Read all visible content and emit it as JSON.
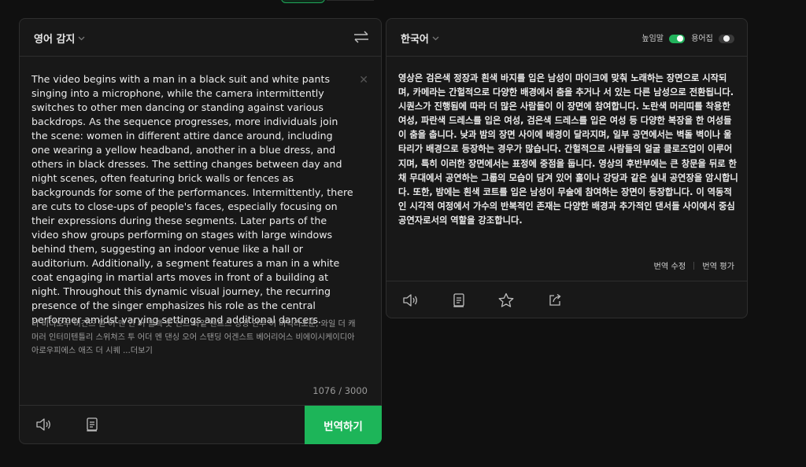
{
  "source": {
    "language": "영어 감지",
    "text": "The video begins with a man in a black suit and white pants singing into a microphone, while the camera intermittently switches to other men dancing or standing against various backdrops. As the sequence progresses, more individuals join the scene: women in different attire dance around, including one wearing a yellow headband, another in a blue dress, and others in black dresses. The setting changes between day and night scenes, often featuring brick walls or fences as backgrounds for some of the performances. Intermittently, there are cuts to close-ups of people's faces, especially focusing on their expressions during these segments. Later parts of the video show groups performing on stages with large windows behind them, suggesting an indoor venue like a hall or auditorium. Additionally, a segment features a man in a white coat engaging in martial arts moves in front of a building at night. Throughout this dynamic visual journey, the recurring presence of the singer emphasizes his role as the central performer amidst varying settings and additional dancers.",
    "romanization": "더 비디오우 비긴즈 윋 어 맨 인 어 블랙 숫 언드 와잍 팬트스 싱잉 인투 어 마익러포운, 와일 더 캐머러 인터미텐틀리 스위쳐즈 투 어더 멘 댄싱 오어 스탠딩 어겐스트 베어리어스 비에이시케이디아아로우피에스 애즈 더 시퀘 ",
    "more_label": "...더보기",
    "char_count": "1076 / 3000",
    "translate_label": "번역하기"
  },
  "target": {
    "language": "한국어",
    "honorific_label": "높임말",
    "glossary_label": "용어집",
    "honorific_on": true,
    "glossary_on": false,
    "text": "영상은 검은색 정장과 흰색 바지를 입은 남성이 마이크에 맞춰 노래하는 장면으로 시작되며, 카메라는 간헐적으로 다양한 배경에서 춤을 추거나 서 있는 다른 남성으로 전환됩니다. 시퀀스가 진행됨에 따라 더 많은 사람들이 이 장면에 참여합니다. 노란색 머리띠를 착용한 여성, 파란색 드레스를 입은 여성, 검은색 드레스를 입은 여성 등 다양한 복장을 한 여성들이 춤을 춥니다. 낮과 밤의 장면 사이에 배경이 달라지며, 일부 공연에서는 벽돌 벽이나 울타리가 배경으로 등장하는 경우가 많습니다. 간헐적으로 사람들의 얼굴 클로즈업이 이루어지며, 특히 이러한 장면에서는 표정에 중점을 둡니다. 영상의 후반부에는 큰 창문을 뒤로 한 채 무대에서 공연하는 그룹의 모습이 담겨 있어 홀이나 강당과 같은 실내 공연장을 암시합니다. 또한, 밤에는 흰색 코트를 입은 남성이 무술에 참여하는 장면이 등장합니다. 이 역동적인 시각적 여정에서 가수의 반복적인 존재는 다양한 배경과 추가적인 댄서들 사이에서 중심 공연자로서의 역할을 강조합니다.",
    "edit_label": "번역 수정",
    "rate_label": "번역 평가"
  },
  "icons": {
    "swap": "swap-arrows-icon",
    "clear": "close-icon",
    "speaker": "speaker-icon",
    "copy": "copy-icon",
    "star": "star-icon",
    "share": "share-icon",
    "chevron": "chevron-down-icon"
  },
  "colors": {
    "accent": "#1db559",
    "background": "#101010",
    "panel": "#181818"
  }
}
